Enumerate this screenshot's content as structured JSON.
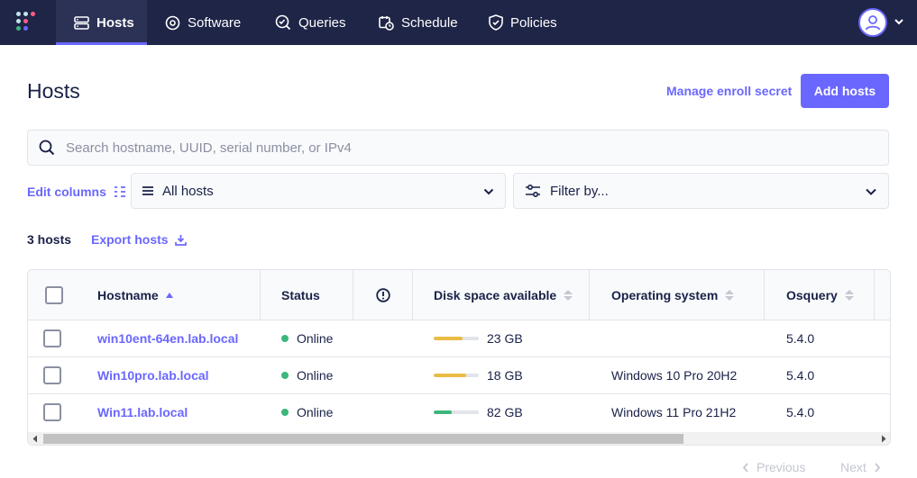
{
  "nav": {
    "items": [
      {
        "label": "Hosts",
        "icon": "hosts-icon",
        "active": true
      },
      {
        "label": "Software",
        "icon": "software-icon",
        "active": false
      },
      {
        "label": "Queries",
        "icon": "queries-icon",
        "active": false
      },
      {
        "label": "Schedule",
        "icon": "schedule-icon",
        "active": false
      },
      {
        "label": "Policies",
        "icon": "policies-icon",
        "active": false
      }
    ]
  },
  "header": {
    "title": "Hosts",
    "manage_secret": "Manage enroll secret",
    "add_hosts": "Add hosts"
  },
  "search": {
    "placeholder": "Search hostname, UUID, serial number, or IPv4"
  },
  "filters": {
    "edit_columns": "Edit columns",
    "hosts_dropdown": "All hosts",
    "filter_dropdown": "Filter by..."
  },
  "summary": {
    "count": "3 hosts",
    "export": "Export hosts"
  },
  "table": {
    "columns": [
      "Hostname",
      "Status",
      "Disk space available",
      "Operating system",
      "Osquery"
    ],
    "rows": [
      {
        "hostname": "win10ent-64en.lab.local",
        "status": "Online",
        "disk": "23 GB",
        "disk_fraction": 0.64,
        "disk_color": "#ebbc43",
        "os": "",
        "osquery": "5.4.0"
      },
      {
        "hostname": "Win10pro.lab.local",
        "status": "Online",
        "disk": "18 GB",
        "disk_fraction": 0.72,
        "disk_color": "#ebbc43",
        "os": "Windows 10 Pro 20H2",
        "osquery": "5.4.0"
      },
      {
        "hostname": "Win11.lab.local",
        "status": "Online",
        "disk": "82 GB",
        "disk_fraction": 0.4,
        "disk_color": "#3db67b",
        "os": "Windows 11 Pro 21H2",
        "osquery": "5.4.0"
      }
    ]
  },
  "pagination": {
    "previous": "Previous",
    "next": "Next"
  },
  "colors": {
    "nav_bg": "#1f2547",
    "accent": "#6a67fe",
    "online": "#3db67b"
  }
}
